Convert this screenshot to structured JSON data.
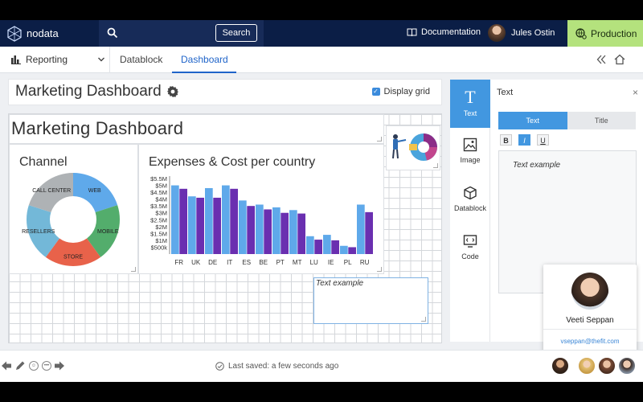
{
  "topbar": {
    "brand": "nodata",
    "search_label": "Search",
    "documentation": "Documentation",
    "user_name": "Jules Ostin",
    "environment": "Production"
  },
  "subbar": {
    "section": "Reporting",
    "tabs": [
      "Datablock",
      "Dashboard"
    ]
  },
  "page": {
    "title": "Marketing Dashboard",
    "display_grid": "Display grid"
  },
  "canvas": {
    "dashboard_heading": "Marketing Dashboard",
    "text_block": "Text example"
  },
  "chart_data": [
    {
      "type": "pie",
      "title": "Channel",
      "donut": true,
      "categories": [
        "WEB",
        "MOBILE",
        "STORE",
        "RESELLERS",
        "CALL CENTER"
      ],
      "values": [
        20,
        20,
        20,
        20,
        20
      ],
      "colors": [
        "#5fa9ea",
        "#53ad6c",
        "#e8624a",
        "#73b8d8",
        "#aeb2b5"
      ]
    },
    {
      "type": "bar",
      "title": "Expenses & Cost per country",
      "categories": [
        "FR",
        "UK",
        "DE",
        "IT",
        "ES",
        "BE",
        "PT",
        "MT",
        "LU",
        "IE",
        "PL",
        "RU"
      ],
      "series": [
        {
          "values": [
            5.0,
            4.2,
            4.8,
            5.0,
            3.9,
            3.6,
            3.4,
            3.2,
            1.3,
            1.4,
            0.6,
            3.6
          ],
          "color": "#5fa9ea"
        },
        {
          "values": [
            4.75,
            4.1,
            4.1,
            4.75,
            3.5,
            3.25,
            3.0,
            2.95,
            1.05,
            1.0,
            0.5,
            3.05
          ],
          "color": "#6a2fb0"
        }
      ],
      "ylim": [
        0,
        5.5
      ],
      "yticks": [
        "$500k",
        "$1M",
        "$1.5M",
        "$2M",
        "$2.5M",
        "$3M",
        "$3.5M",
        "$4M",
        "$4.5M",
        "$5M",
        "$5.5M"
      ]
    }
  ],
  "rail": {
    "items": [
      {
        "label": "Text",
        "icon": "T"
      },
      {
        "label": "Image",
        "icon": "🖾"
      },
      {
        "label": "Datablock",
        "icon": "⬡"
      },
      {
        "label": "Code",
        "icon": "⌨"
      }
    ]
  },
  "text_panel": {
    "title": "Text",
    "close": "×",
    "tabs": [
      "Text",
      "Title"
    ],
    "formats": [
      "B",
      "I",
      "U"
    ],
    "editor_text": "Text example"
  },
  "popup": {
    "name": "Veeti Seppan",
    "email": "vseppan@thefit.com"
  },
  "footer": {
    "saved": "Last saved: a few seconds ago"
  }
}
